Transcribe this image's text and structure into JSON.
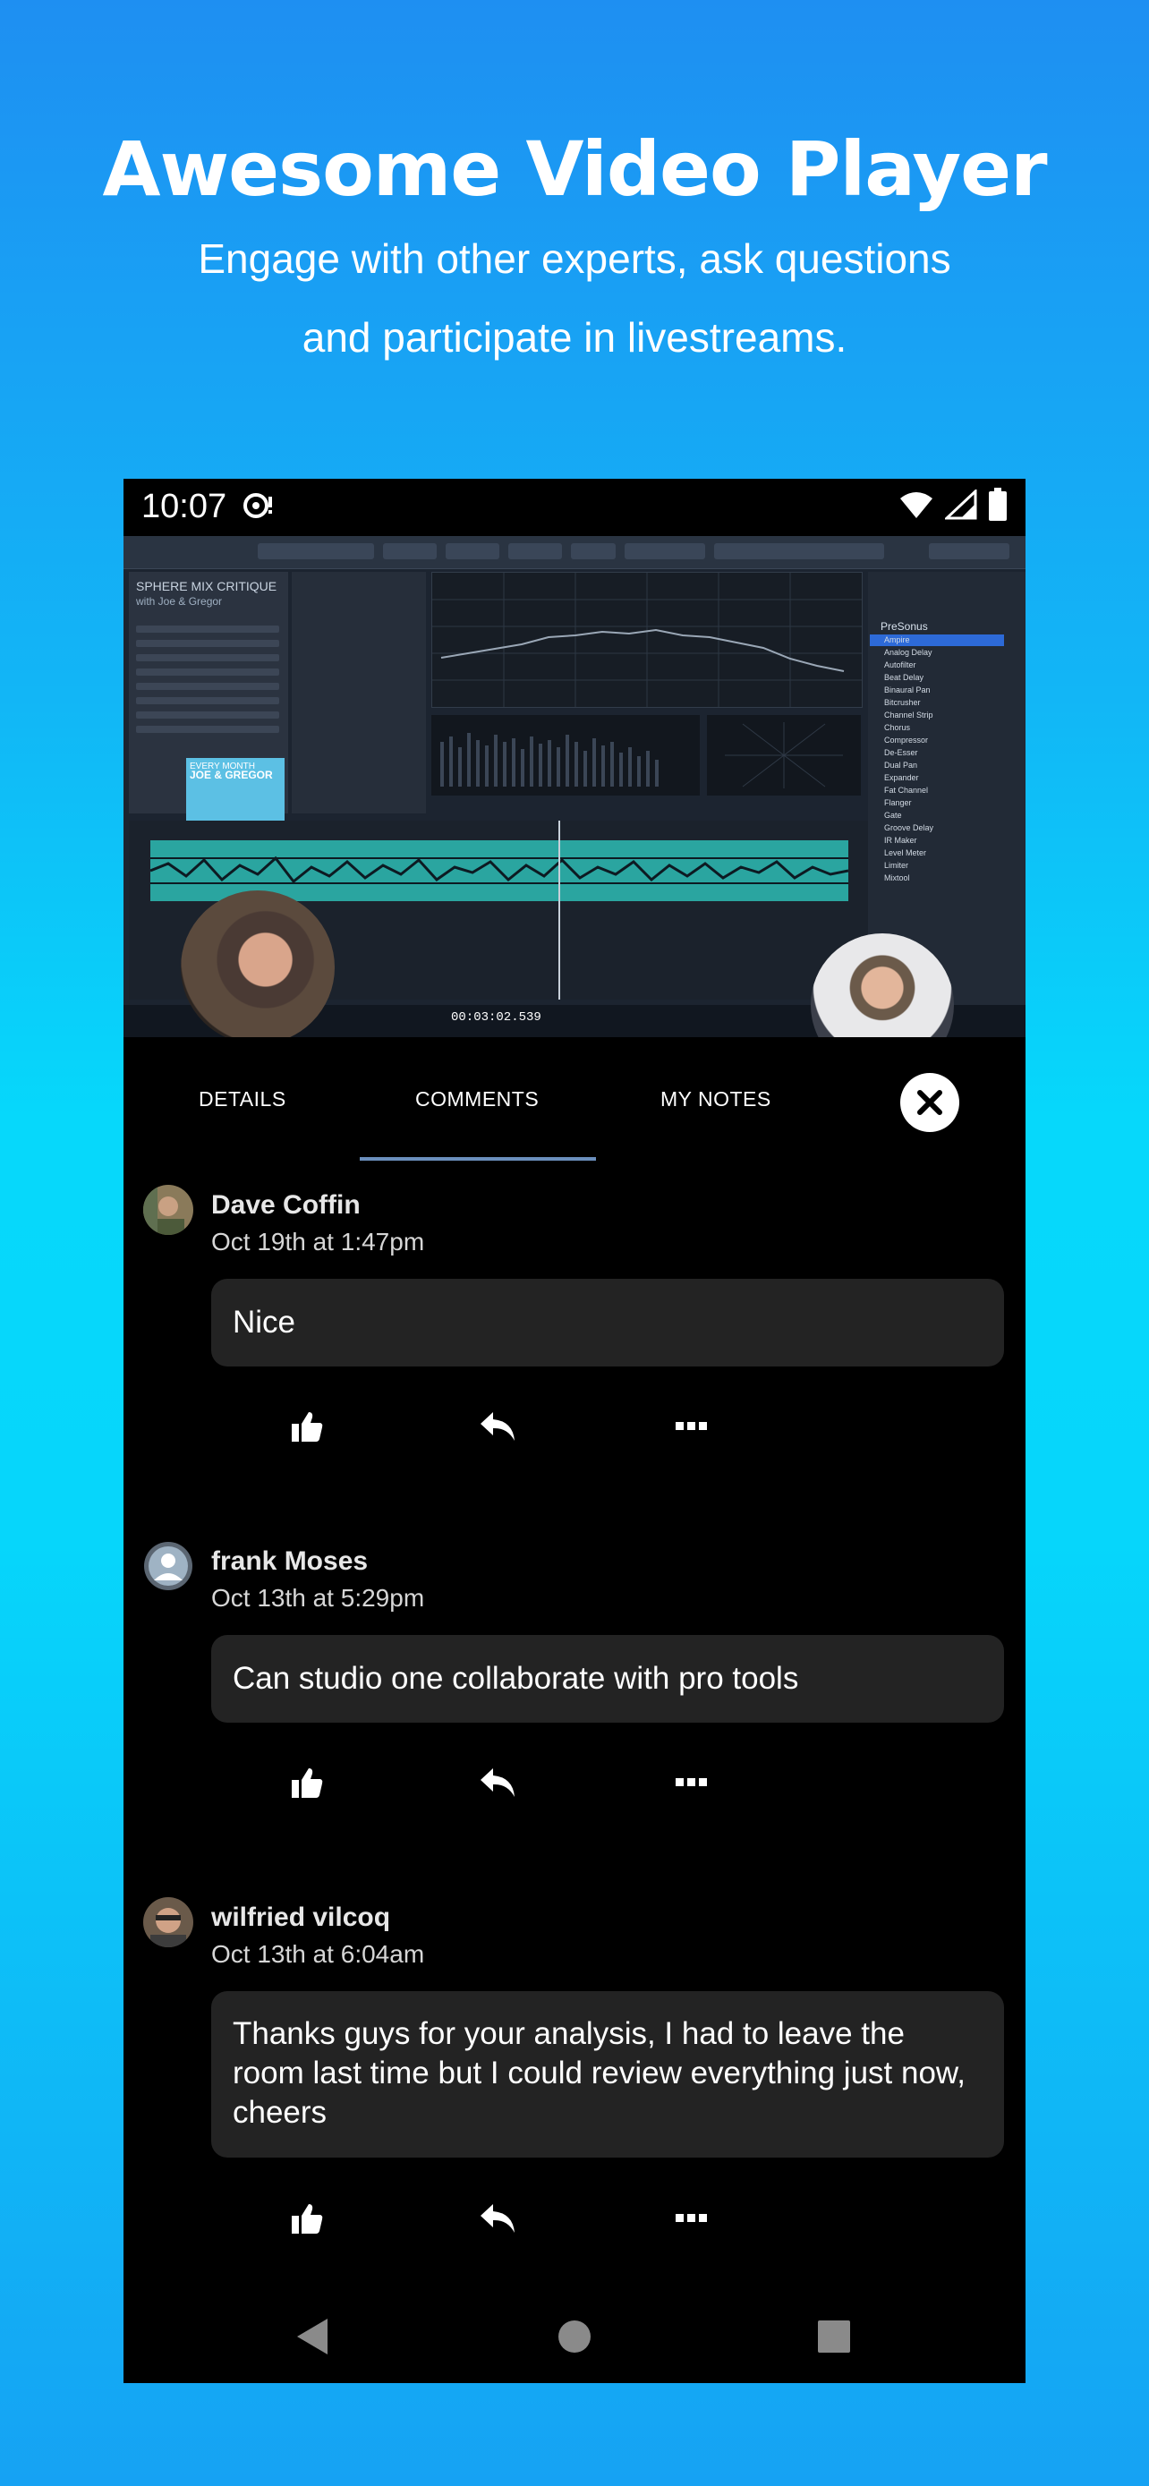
{
  "promo": {
    "headline": "Awesome Video Player",
    "subline_1": "Engage with other experts, ask questions",
    "subline_2": "and participate in livestreams."
  },
  "status_bar": {
    "time": "10:07",
    "icons": [
      "cast-icon",
      "wifi-icon",
      "signal-icon",
      "battery-icon"
    ]
  },
  "video": {
    "session_title": "SPHERE MIX CRITIQUE",
    "session_subtitle": "with Joe & Gregor",
    "cover_title": "JOE & GREGOR",
    "cover_tag": "EVERY MONTH",
    "plugin_header": "PreSonus",
    "plugins": [
      "Ampire",
      "Analog Delay",
      "Autofilter",
      "Beat Delay",
      "Binaural Pan",
      "Bitcrusher",
      "Channel Strip",
      "Chorus",
      "Compressor",
      "De-Esser",
      "Dual Pan",
      "Expander",
      "Fat Channel",
      "Flanger",
      "Gate",
      "Groove Delay",
      "IR Maker",
      "Level Meter",
      "Limiter",
      "Mixtool"
    ],
    "transport_time": "00:03:02.539"
  },
  "tabs": [
    {
      "label": "DETAILS",
      "active": false
    },
    {
      "label": "COMMENTS",
      "active": true
    },
    {
      "label": "MY NOTES",
      "active": false
    }
  ],
  "comments": [
    {
      "author": "Dave Coffin",
      "date": "Oct 19th at 1:47pm",
      "text": "Nice"
    },
    {
      "author": "frank Moses",
      "date": "Oct 13th at 5:29pm",
      "text": "Can studio one collaborate with pro tools"
    },
    {
      "author": "wilfried vilcoq",
      "date": "Oct 13th at 6:04am",
      "text": "Thanks guys for your analysis, I had to leave the room last time but I could review everything just now, cheers"
    }
  ],
  "colors": {
    "accent_underline": "#6b8fbd",
    "bubble_bg": "#232323",
    "panel_bg": "#000000"
  }
}
